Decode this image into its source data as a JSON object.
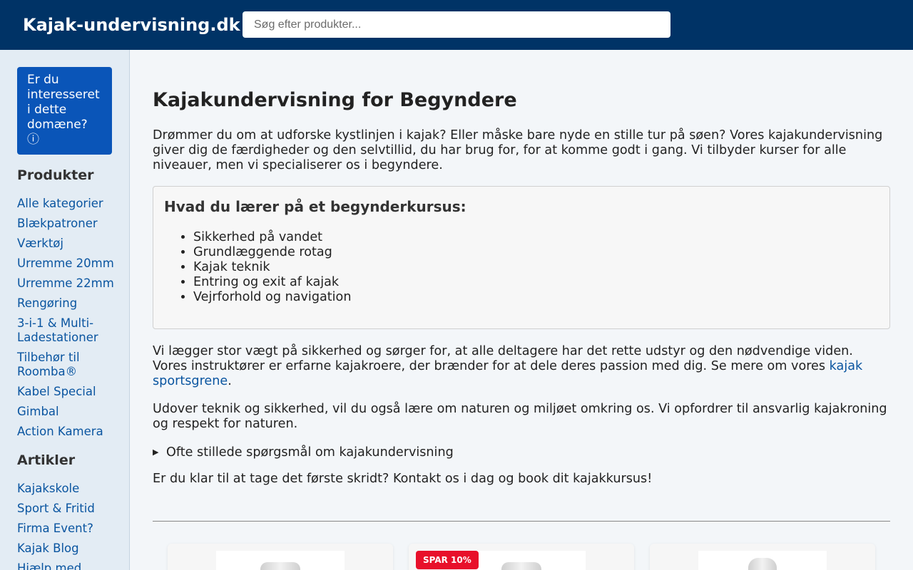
{
  "header": {
    "logo": "Kajak-undervisning.dk",
    "search_placeholder": "Søg efter produkter..."
  },
  "sidebar": {
    "cta": "Er du interesseret i dette domæne? ⓘ",
    "products_heading": "Produkter",
    "products": [
      "Alle kategorier",
      "Blækpatroner",
      "Værktøj",
      "Urremme 20mm",
      "Urremme 22mm",
      "Rengøring",
      "3-i-1 & Multi-Ladestationer",
      "Tilbehør til Roomba®",
      "Kabel Special",
      "Gimbal",
      "Action Kamera"
    ],
    "articles_heading": "Artikler",
    "articles": [
      "Kajakskole",
      "Sport & Fritid",
      "Firma Event?",
      "Kajak Blog",
      "Hjælp med"
    ]
  },
  "main": {
    "title": "Kajakundervisning for Begyndere",
    "intro": "Drømmer du om at udforske kystlinjen i kajak? Eller måske bare nyde en stille tur på søen? Vores kajakundervisning giver dig de færdigheder og den selvtillid, du har brug for, for at komme godt i gang. Vi tilbyder kurser for alle niveauer, men vi specialiserer os i begyndere.",
    "box_title": "Hvad du lærer på et begynderkursus:",
    "box_items": [
      "Sikkerhed på vandet",
      "Grundlæggende rotag",
      "Kajak teknik",
      "Entring og exit af kajak",
      "Vejrforhold og navigation"
    ],
    "para2_text": "Vi lægger stor vægt på sikkerhed og sørger for, at alle deltagere har det rette udstyr og den nødvendige viden. Vores instruktører er erfarne kajakroere, der brænder for at dele deres passion med dig. Se mere om vores ",
    "para2_link": "kajak sportsgrene",
    "para2_end": ".",
    "para3": "Udover teknik og sikkerhed, vil du også lære om naturen og miljøet omkring os. Vi opfordrer til ansvarlig kajakroning og respekt for naturen.",
    "faq": "Ofte stillede spørgsmål om kajakundervisning",
    "cta_text": "Er du klar til at tage det første skridt? Kontakt os i dag og book dit kajakkursus!"
  },
  "products": {
    "badge": "SPAR 10%"
  }
}
